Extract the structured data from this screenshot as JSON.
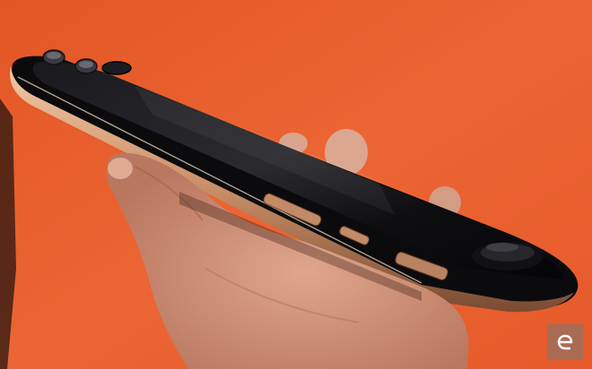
{
  "photo": {
    "subject": "handheld-game-console-side-view",
    "background_color": "#e8602e",
    "body_color": "#0b0b0d",
    "trim_color": "#d9a07a",
    "skin_color": "#d99c82"
  },
  "watermark": {
    "icon": "engadget-logo-icon"
  }
}
